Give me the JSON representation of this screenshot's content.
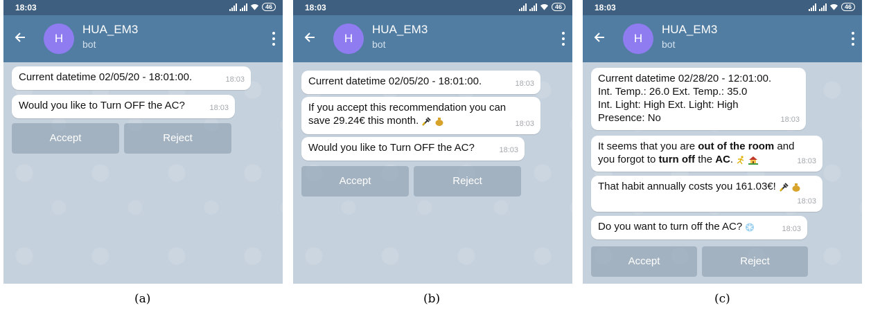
{
  "panels": [
    {
      "status_time": "18:03",
      "battery": "46",
      "chat_title": "HUA_EM3",
      "chat_subtitle": "bot",
      "avatar_letter": "H",
      "messages": [
        {
          "text": "Current datetime 02/05/20 - 18:01:00.",
          "time": "18:03"
        },
        {
          "text": "Would you like to Turn OFF the AC?",
          "time": "18:03"
        }
      ],
      "buttons": {
        "accept": "Accept",
        "reject": "Reject"
      },
      "caption": "(a)"
    },
    {
      "status_time": "18:03",
      "battery": "46",
      "chat_title": "HUA_EM3",
      "chat_subtitle": "bot",
      "avatar_letter": "H",
      "messages": [
        {
          "text": "Current datetime 02/05/20 - 18:01:00.",
          "time": "18:03"
        },
        {
          "line1": "If you accept this recommendation you can",
          "line2": "save 29.24€ this month.",
          "time": "18:03"
        },
        {
          "text": "Would you like to Turn OFF the AC?",
          "time": "18:03"
        }
      ],
      "buttons": {
        "accept": "Accept",
        "reject": "Reject"
      },
      "caption": "(b)"
    },
    {
      "status_time": "18:03",
      "battery": "46",
      "chat_title": "HUA_EM3",
      "chat_subtitle": "bot",
      "avatar_letter": "H",
      "messages": [
        {
          "line1": "Current datetime 02/28/20 - 12:01:00.",
          "line2": "Int. Temp.: 26.0 Ext. Temp.: 35.0",
          "line3": "Int. Light: High Ext. Light: High",
          "line4": "Presence: No",
          "time": "18:03"
        },
        {
          "p1": "It seems that you are ",
          "b1": "out of the room",
          "p2": " and",
          "p3": "you forgot to ",
          "b2": "turn off",
          "p4": " the ",
          "b3": "AC",
          "p5": ".",
          "time": "18:03"
        },
        {
          "text": "That habit annually costs you 161.03€!",
          "time": "18:03"
        },
        {
          "text": "Do you want to turn off the AC?",
          "time": "18:03"
        }
      ],
      "buttons": {
        "accept": "Accept",
        "reject": "Reject"
      },
      "caption": "(c)"
    }
  ],
  "colors": {
    "header": "#517da2",
    "statusbar": "#3e5f7f",
    "avatar": "#8e7cf0",
    "chat_bg": "#c5d1dd"
  },
  "icons": [
    "back-arrow-icon",
    "kebab-menu-icon",
    "signal-icon",
    "wifi-icon",
    "battery-icon",
    "plug-icon",
    "money-bag-icon",
    "running-person-icon",
    "house-icon",
    "snowflake-icon"
  ]
}
